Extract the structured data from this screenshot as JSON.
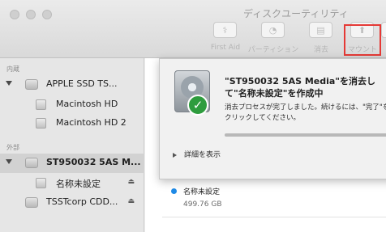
{
  "window": {
    "title": "ディスクユーティリティ"
  },
  "toolbar": {
    "first_aid": "First Aid",
    "partition": "パーティション",
    "erase": "消去",
    "mount": "マウント"
  },
  "sidebar": {
    "internal_label": "内蔵",
    "external_label": "外部",
    "items": [
      {
        "label": "APPLE SSD TS..."
      },
      {
        "label": "Macintosh HD"
      },
      {
        "label": "Macintosh HD 2"
      },
      {
        "label": "ST950032 5AS M..."
      },
      {
        "label": "名称未設定",
        "eject": "⏏"
      },
      {
        "label": "TSSTcorp CDD...",
        "eject": "⏏"
      }
    ]
  },
  "sheet": {
    "title": "\"ST950032 5AS Media\"を消去して\"名称未設定\"を作成中",
    "message": "消去プロセスが完了しました。続けるには、\"完了\"をクリックしてください。",
    "progress": 1.0,
    "details": "詳細を表示"
  },
  "volume": {
    "name": "名称未設定",
    "size": "499.76 GB",
    "color": "#1f8ae6"
  },
  "colors": {
    "highlight": "#e53935",
    "success": "#2e9c3e"
  }
}
